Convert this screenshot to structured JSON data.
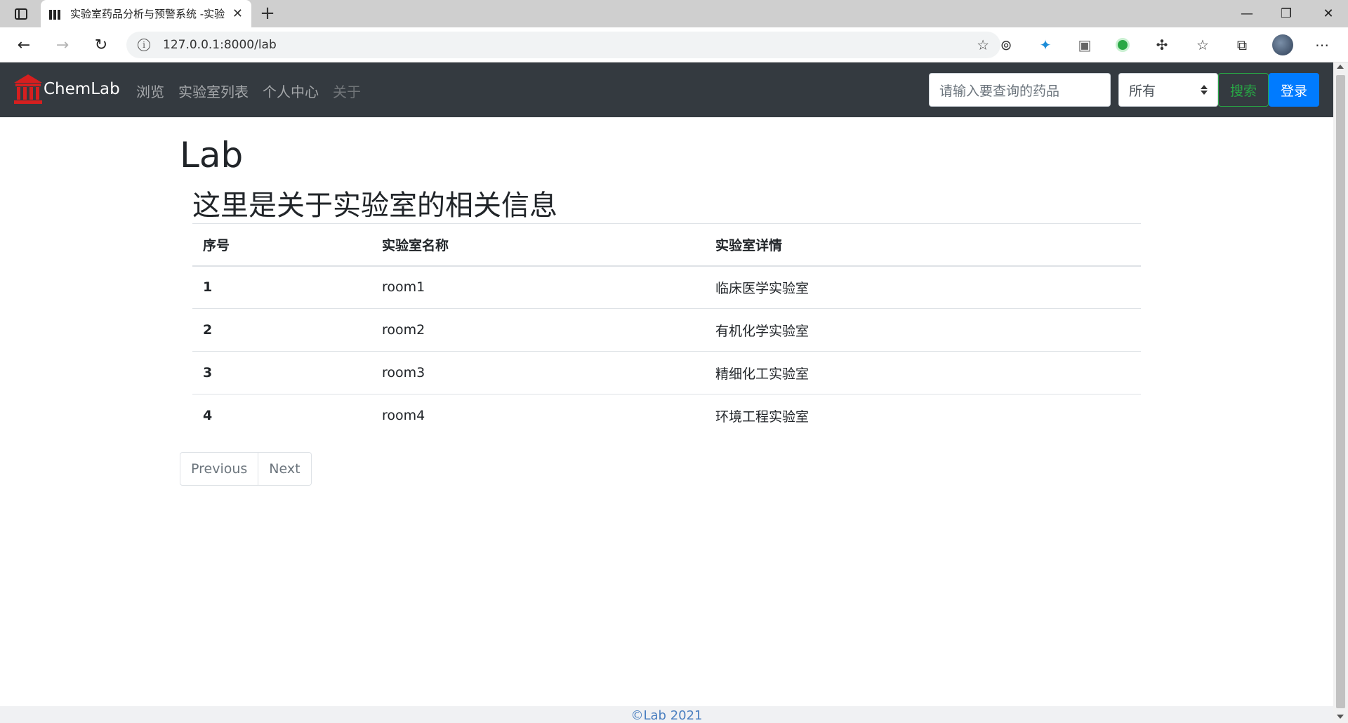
{
  "browser": {
    "tab_title": "实验室药品分析与预警系统 -实验",
    "url": "127.0.0.1:8000/lab"
  },
  "navbar": {
    "brand": "ChemLab",
    "links": [
      "浏览",
      "实验室列表",
      "个人中心",
      "关于"
    ],
    "search_placeholder": "请输入要查询的药品",
    "select_value": "所有",
    "search_button": "搜索",
    "login_button": "登录"
  },
  "main": {
    "title": "Lab",
    "subtitle": "这里是关于实验室的相关信息",
    "table": {
      "headers": [
        "序号",
        "实验室名称",
        "实验室详情"
      ],
      "rows": [
        [
          "1",
          "room1",
          "临床医学实验室"
        ],
        [
          "2",
          "room2",
          "有机化学实验室"
        ],
        [
          "3",
          "room3",
          "精细化工实验室"
        ],
        [
          "4",
          "room4",
          "环境工程实验室"
        ]
      ]
    },
    "pagination": {
      "previous": "Previous",
      "next": "Next"
    }
  },
  "footer": {
    "text": "©Lab 2021"
  },
  "colors": {
    "navbar_bg": "#343a40",
    "brand_icon": "#d61f1f",
    "search_button": "#28a745",
    "login_button": "#007bff",
    "footer_text": "#4a7fc0"
  }
}
